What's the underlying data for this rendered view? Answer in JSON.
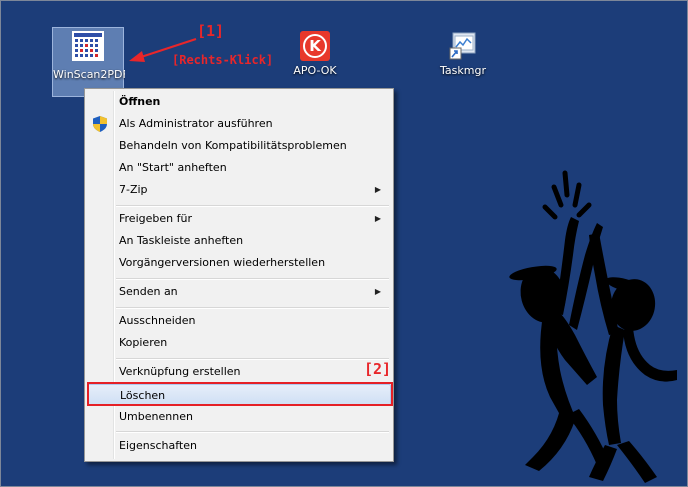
{
  "desktop": {
    "icons": [
      {
        "label": "WinScan2PDF"
      },
      {
        "label": "APO-OK"
      },
      {
        "label": "Taskmgr"
      }
    ]
  },
  "annotations": {
    "step1": "[1]",
    "right_click": "[Rechts-Klick]",
    "step2": "[2]"
  },
  "context_menu": {
    "items": [
      "Öffnen",
      "Als Administrator ausführen",
      "Behandeln von Kompatibilitätsproblemen",
      "An \"Start\" anheften",
      "7-Zip",
      "Freigeben für",
      "An Taskleiste anheften",
      "Vorgängerversionen wiederherstellen",
      "Senden an",
      "Ausschneiden",
      "Kopieren",
      "Verknüpfung erstellen",
      "Löschen",
      "Umbenennen",
      "Eigenschaften"
    ]
  },
  "colors": {
    "desktop_background": "#1c3d79",
    "annotation_red": "#e8262a"
  },
  "icons": {
    "winscan": "winscan2pdf-app-icon",
    "apo": "apo-ok-app-icon",
    "taskmgr": "taskmgr-shortcut-icon",
    "uac": "uac-shield-icon",
    "submenu": "chevron-right-icon"
  }
}
